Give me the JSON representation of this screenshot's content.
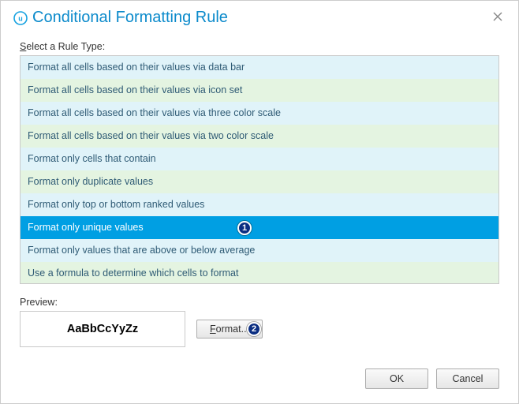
{
  "dialog": {
    "title": "Conditional Formatting Rule"
  },
  "section": {
    "select_label_pre": "S",
    "select_label_rest": "elect a Rule Type:"
  },
  "rules": {
    "items": [
      {
        "label": "Format all cells based on their values via data bar",
        "selected": false,
        "marker": null
      },
      {
        "label": "Format all cells based on their values via icon set",
        "selected": false,
        "marker": null
      },
      {
        "label": "Format all cells based on their values via three color scale",
        "selected": false,
        "marker": null
      },
      {
        "label": "Format all cells based on their values via two color scale",
        "selected": false,
        "marker": null
      },
      {
        "label": "Format only cells that contain",
        "selected": false,
        "marker": null
      },
      {
        "label": "Format only duplicate values",
        "selected": false,
        "marker": null
      },
      {
        "label": "Format only top or bottom ranked values",
        "selected": false,
        "marker": null
      },
      {
        "label": "Format only unique values",
        "selected": true,
        "marker": "1"
      },
      {
        "label": "Format only values that are above or below average",
        "selected": false,
        "marker": null
      },
      {
        "label": "Use a formula to determine which cells to format",
        "selected": false,
        "marker": null
      }
    ]
  },
  "preview": {
    "label": "Preview:",
    "sample_text": "AaBbCcYyZz"
  },
  "buttons": {
    "format_pre": "F",
    "format_rest": "ormat...",
    "format_marker": "2",
    "ok": "OK",
    "cancel": "Cancel"
  },
  "colors": {
    "accent": "#0b8acb",
    "selected": "#009fe3",
    "row_blue": "#e0f3f9",
    "row_green": "#e4f4e1",
    "marker_fill": "#0b2e82"
  }
}
